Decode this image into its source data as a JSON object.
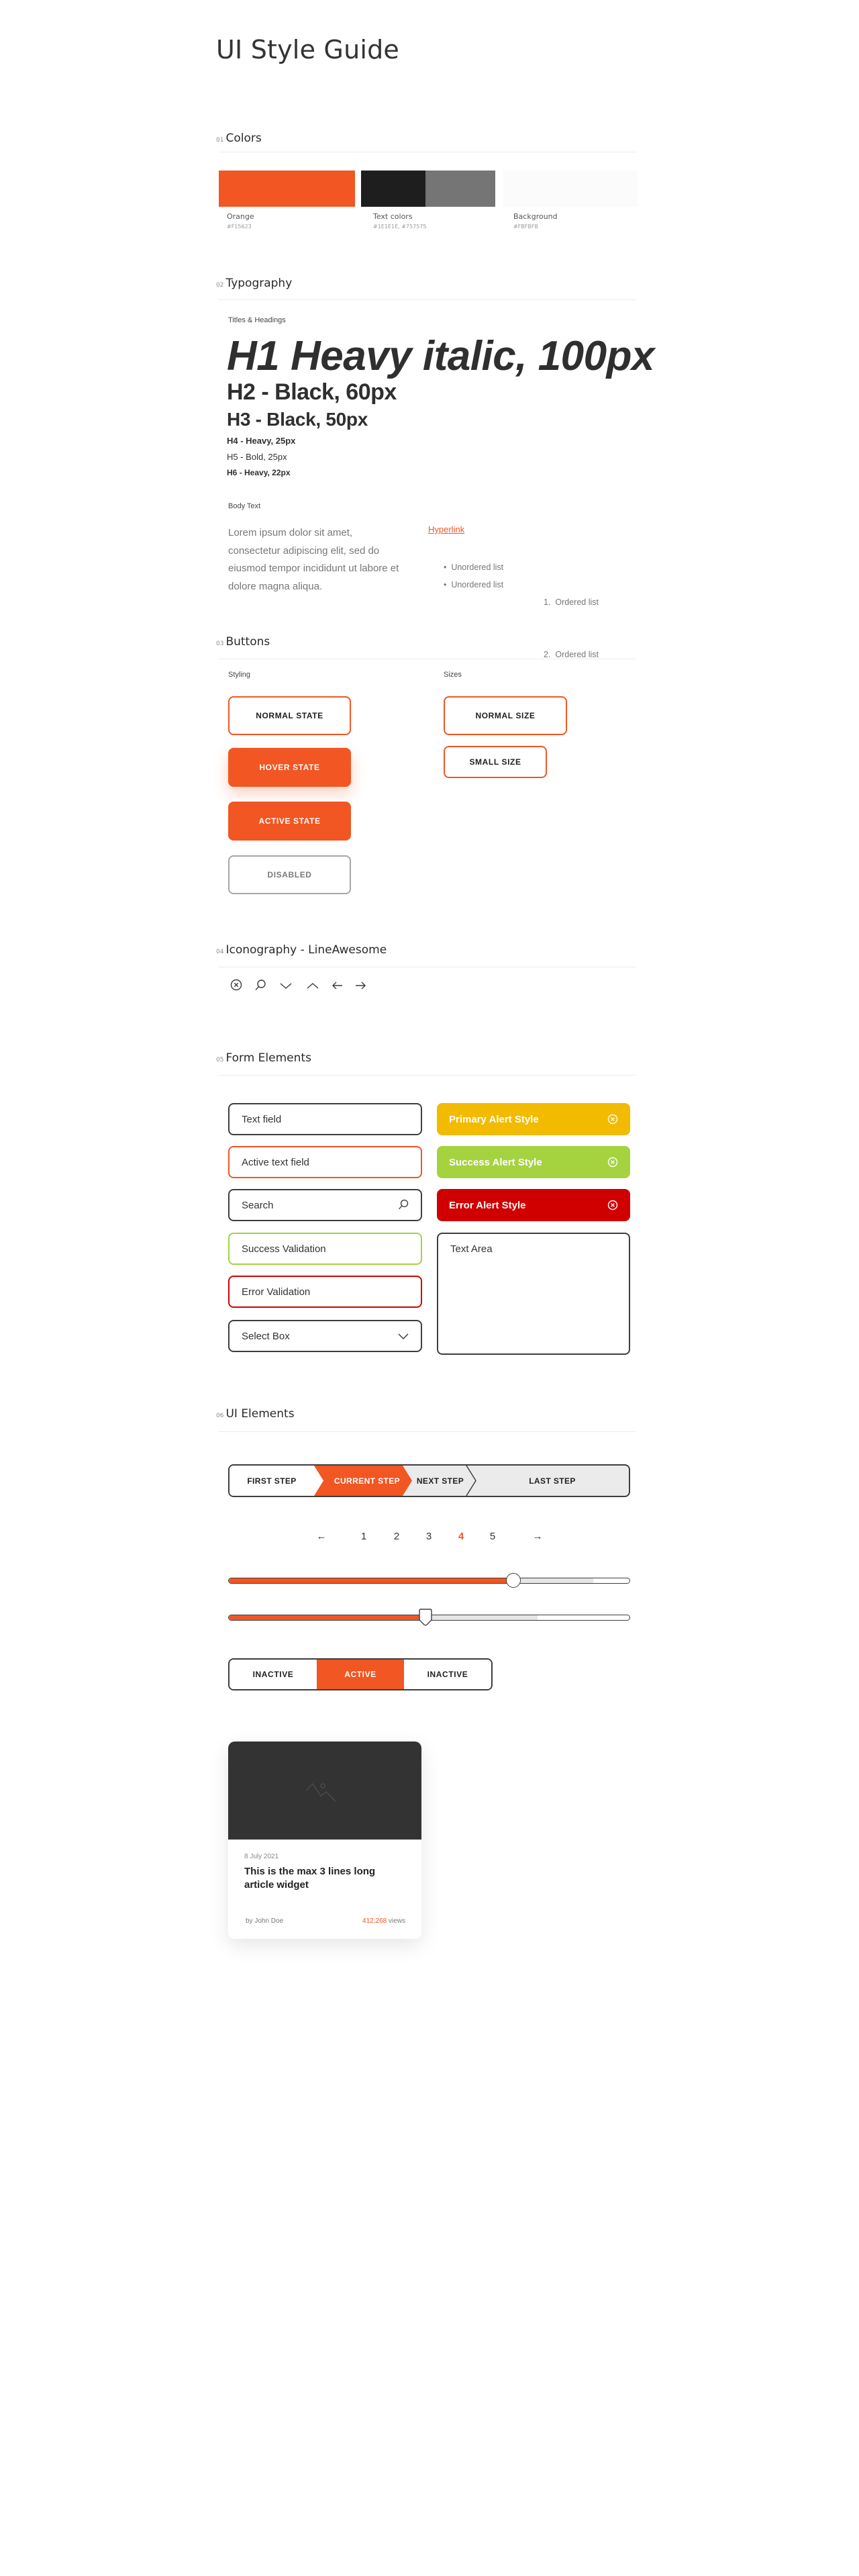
{
  "page_title": "UI Style Guide",
  "sections": {
    "colors": {
      "num": "01",
      "title": "Colors"
    },
    "typography": {
      "num": "02",
      "title": "Typography"
    },
    "buttons": {
      "num": "03",
      "title": "Buttons"
    },
    "iconography": {
      "num": "04",
      "title": "Iconography - LineAwesome"
    },
    "forms": {
      "num": "05",
      "title": "Form Elements"
    },
    "ui": {
      "num": "06",
      "title": "UI Elements"
    }
  },
  "colors": {
    "orange": {
      "label": "Orange",
      "hex_label": "#F15623",
      "hex": "#F15623"
    },
    "text": {
      "label": "Text colors",
      "hex_label": "#1E1E1E, #757575",
      "hex_dark": "#1E1E1E",
      "hex_grey": "#757575"
    },
    "background": {
      "label": "Background",
      "hex_label": "#FBFBFB",
      "hex": "#FBFBFB"
    }
  },
  "typography": {
    "titles_label": "Titles & Headings",
    "h1": "H1 Heavy italic, 100px",
    "h2": "H2 - Black, 60px",
    "h3": "H3 - Black, 50px",
    "h4": "H4 - Heavy, 25px",
    "h5": "H5 - Bold, 25px",
    "h6": "H6 - Heavy, 22px",
    "body_label": "Body Text",
    "body": "Lorem ipsum dolor sit amet, consectetur adipiscing elit, sed do eiusmod tempor incididunt ut labore et dolore magna aliqua.",
    "hyperlink": "Hyperlink",
    "unordered": [
      "Unordered list",
      "Unordered list"
    ],
    "ordered": [
      "1.  Ordered list",
      "2.  Ordered list"
    ]
  },
  "buttons": {
    "styling_label": "Styling",
    "sizes_label": "Sizes",
    "normal": "NORMAL STATE",
    "hover": "HOVER STATE",
    "active": "ACTIVE STATE",
    "disabled": "DISABLED",
    "normal_size": "NORMAL SIZE",
    "small_size": "SMALL SIZE"
  },
  "icons": [
    "close-circle-icon",
    "search-icon",
    "chevron-down-icon",
    "chevron-up-icon",
    "arrow-left-icon",
    "arrow-right-icon"
  ],
  "forms": {
    "text_field": "Text field",
    "active_field": "Active text field",
    "search": "Search",
    "success_field": "Success Validation",
    "error_field": "Error Validation",
    "select": "Select Box",
    "alert_primary": "Primary Alert Style",
    "alert_success": "Success Alert Style",
    "alert_error": "Error Alert Style",
    "textarea": "Text Area",
    "alert_colors": {
      "primary": "#F2BB00",
      "success": "#A5D33F",
      "error": "#D10000"
    }
  },
  "ui": {
    "steps": [
      "FIRST STEP",
      "CURRENT STEP",
      "NEXT STEP",
      "LAST STEP"
    ],
    "current_step": 1,
    "pages": [
      "1",
      "2",
      "3",
      "4",
      "5"
    ],
    "current_page": "4",
    "prev_label": "←",
    "next_label": "→",
    "slider1": {
      "value": 0.71,
      "buffer": 0.91
    },
    "slider2": {
      "value": 0.49,
      "buffer": 0.77
    },
    "toggle": [
      "INACTIVE",
      "ACTIVE",
      "INACTIVE"
    ],
    "toggle_active": 1,
    "card": {
      "date": "8 July 2021",
      "title": "This is the max 3 lines long article widget",
      "author": "by John Doe",
      "views_num": "412,268",
      "views_suffix": " views"
    }
  }
}
